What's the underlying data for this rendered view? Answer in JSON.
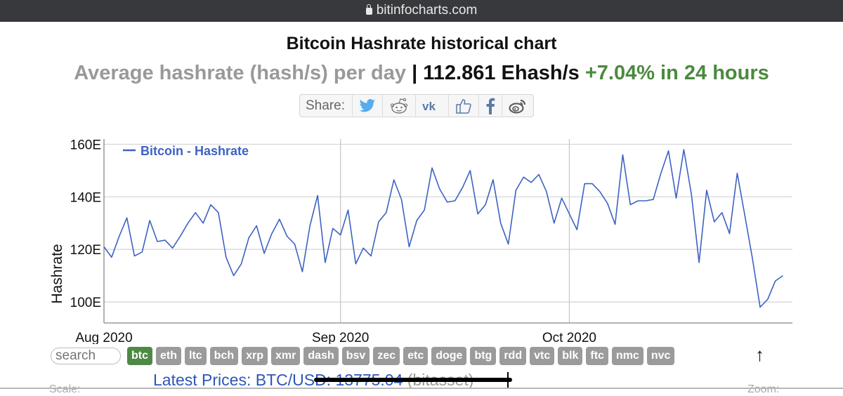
{
  "browser": {
    "url": "bitinfocharts.com"
  },
  "header": {
    "title": "Bitcoin Hashrate historical chart",
    "subtitle_label": "Average hashrate (hash/s) per day",
    "separator": "|",
    "current_value": "112.861 Ehash/s",
    "change": "+7.04% in 24 hours"
  },
  "share": {
    "label": "Share:",
    "buttons": [
      "twitter",
      "reddit",
      "vk",
      "like",
      "facebook",
      "weibo"
    ]
  },
  "colors": {
    "series": "#3d62c2",
    "change_positive": "#4a8a3e",
    "active_coin": "#4e8a45",
    "inactive_coin": "#9b9b9b",
    "link": "#2e56b8"
  },
  "coins": {
    "search_placeholder": "search",
    "items": [
      "btc",
      "eth",
      "ltc",
      "bch",
      "xrp",
      "xmr",
      "dash",
      "bsv",
      "zec",
      "etc",
      "doge",
      "btg",
      "rdd",
      "vtc",
      "blk",
      "ftc",
      "nmc",
      "nvc"
    ],
    "active": "btc",
    "scroll_top_icon": "↑"
  },
  "footer": {
    "latest_label": "Latest Prices: BTC/USD: 13775.04",
    "latest_source": " (bitasset)",
    "scale_label": "Scale:",
    "zoom_label": "Zoom:"
  },
  "chart_data": {
    "type": "line",
    "title": "Bitcoin Hashrate historical chart",
    "xlabel": "",
    "ylabel": "Hashrate",
    "x_start": "2020-08-01",
    "x_interval": "1 day",
    "x_ticks": [
      "Aug 2020",
      "Sep 2020",
      "Oct 2020"
    ],
    "x_tick_day_index": [
      0,
      31,
      61
    ],
    "y_ticks": [
      100,
      120,
      140,
      160
    ],
    "y_tick_labels": [
      "100E",
      "120E",
      "140E",
      "160E"
    ],
    "ylim": [
      92,
      162
    ],
    "grid": true,
    "legend": {
      "position": "top-left",
      "entries": [
        "Bitcoin - Hashrate"
      ]
    },
    "series": [
      {
        "name": "Bitcoin - Hashrate",
        "unit": "Ehash/s",
        "values": [
          121,
          117,
          125,
          132,
          117.5,
          119,
          131,
          123,
          123.5,
          120.5,
          125,
          130,
          134,
          130,
          137,
          134,
          117,
          110,
          114.5,
          124.5,
          129,
          118.5,
          126,
          131.5,
          125,
          122,
          111.5,
          129,
          140.5,
          115,
          128,
          125.5,
          135,
          114.5,
          120.5,
          117.5,
          130.5,
          134,
          146.5,
          139,
          121,
          131,
          135,
          151,
          143,
          138,
          138.5,
          143.5,
          150,
          133.5,
          137,
          146.5,
          130,
          122,
          142.5,
          147.5,
          145.5,
          148.5,
          142,
          130,
          139.5,
          133.5,
          127.5,
          145,
          145,
          142,
          137.5,
          129.5,
          156,
          137,
          138.5,
          138.5,
          139,
          149,
          157.5,
          139.5,
          158,
          141,
          115,
          142.5,
          130.5,
          134,
          126,
          149,
          133,
          116.5,
          98,
          101,
          108,
          110
        ]
      }
    ]
  }
}
